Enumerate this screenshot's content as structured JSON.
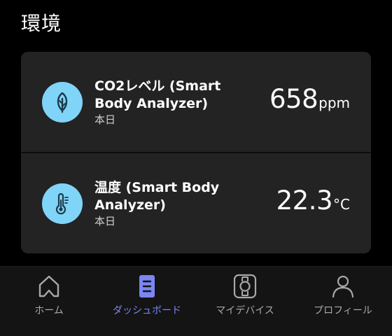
{
  "page": {
    "title": "環境"
  },
  "metrics": [
    {
      "icon": "leaf-icon",
      "label": "CO2レベル (Smart Body Analyzer)",
      "sub": "本日",
      "value": "658",
      "unit": "ppm"
    },
    {
      "icon": "thermometer-icon",
      "label": "温度 (Smart Body Analyzer)",
      "sub": "本日",
      "value": "22.3",
      "unit": "°C"
    }
  ],
  "nav": {
    "active_index": 1,
    "items": [
      {
        "label": "ホーム",
        "icon": "home-icon"
      },
      {
        "label": "ダッシュボード",
        "icon": "dashboard-icon"
      },
      {
        "label": "マイデバイス",
        "icon": "watch-icon"
      },
      {
        "label": "プロフィール",
        "icon": "user-icon"
      }
    ]
  },
  "colors": {
    "background": "#000000",
    "card": "#232323",
    "icon_circle": "#7fd4f8",
    "icon_glyph": "#1c3a4a",
    "nav_bar": "#141414",
    "nav_inactive": "#a8a8a8",
    "nav_active": "#7b86f2"
  }
}
